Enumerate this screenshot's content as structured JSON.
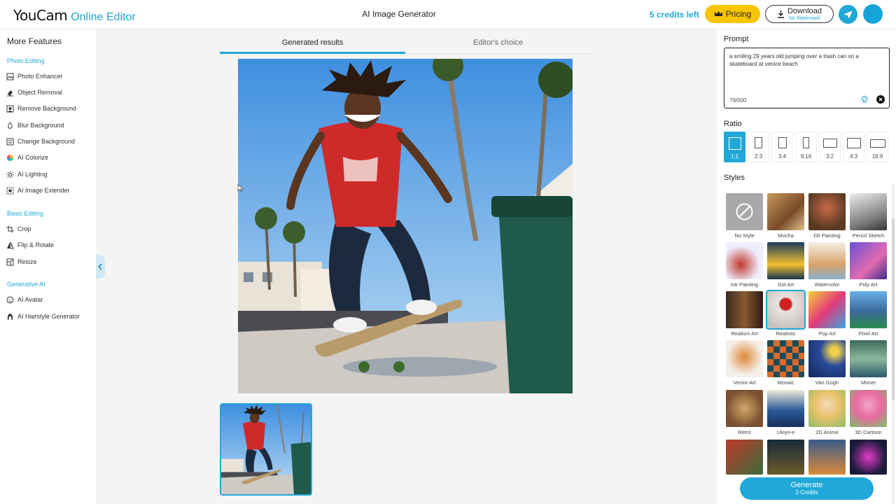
{
  "header": {
    "logo_main": "YouCam",
    "logo_sub": "Online Editor",
    "title": "AI Image Generator",
    "credits": "5 credits left",
    "pricing_label": "Pricing",
    "download_label": "Download",
    "download_sub": "No Watermark"
  },
  "sidebar": {
    "title": "More Features",
    "sections": [
      {
        "title": "Photo Editing",
        "items": [
          "Photo Enhancer",
          "Object Removal",
          "Remove Background",
          "Blur Background",
          "Change Background",
          "AI Colorize",
          "AI Lighting",
          "AI Image Extender"
        ]
      },
      {
        "title": "Basic Editing",
        "items": [
          "Crop",
          "Flip & Rotate",
          "Resize"
        ]
      },
      {
        "title": "Generative AI",
        "items": [
          "AI Avatar",
          "AI Hairstyle Generator"
        ]
      }
    ]
  },
  "tabs": [
    "Generated results",
    "Editor's choice"
  ],
  "prompt": {
    "label": "Prompt",
    "text": "a smiling 29 years old jumping over a trash can on a skateboard at venice beach",
    "count": "79/600"
  },
  "ratio": {
    "label": "Ratio",
    "options": [
      "1:1",
      "2:3",
      "3:4",
      "9:16",
      "3:2",
      "4:3",
      "16:9"
    ],
    "selected": "1:1"
  },
  "styles": {
    "label": "Styles",
    "items": [
      "No Style",
      "Mucha",
      "Oil Painting",
      "Pencil Sketch",
      "Ink Painting",
      "Dot Art",
      "Watercolor",
      "Poly Art",
      "Realism Art",
      "Realistic",
      "Pop Art",
      "Pixel Art",
      "Vector Art",
      "Mosaic",
      "Van Gogh",
      "Monet",
      "Retro",
      "Ukiyo-e",
      "2D Anime",
      "3D Cartoon"
    ],
    "selected": "Realistic"
  },
  "generate": {
    "label": "Generate",
    "sub": "2 Credits"
  },
  "colors": {
    "accent": "#1fa8d8",
    "pricing": "#f9c400"
  }
}
